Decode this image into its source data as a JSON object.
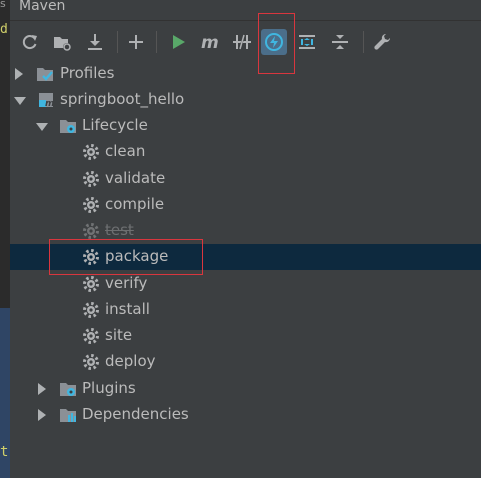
{
  "window": {
    "title": "Maven"
  },
  "editor_fragments": {
    "top": "s",
    "mid": "d",
    "bottom": "t"
  },
  "toolbar": {
    "buttons": [
      {
        "name": "reimport-icon"
      },
      {
        "name": "generate-sources-icon"
      },
      {
        "name": "download-icon"
      },
      {
        "name": "add-project-icon"
      },
      {
        "name": "run-icon"
      },
      {
        "name": "execute-goal-icon"
      },
      {
        "name": "toggle-offline-icon"
      },
      {
        "name": "skip-tests-icon",
        "active": true
      },
      {
        "name": "show-dependencies-icon"
      },
      {
        "name": "collapse-all-icon"
      },
      {
        "name": "settings-icon"
      }
    ]
  },
  "tree": {
    "profiles": "Profiles",
    "project": "springboot_hello",
    "lifecycle": {
      "label": "Lifecycle",
      "goals": [
        "clean",
        "validate",
        "compile",
        "test",
        "package",
        "verify",
        "install",
        "site",
        "deploy"
      ]
    },
    "plugins": "Plugins",
    "dependencies": "Dependencies"
  },
  "colors": {
    "background": "#3c3f41",
    "selection": "#0d293e",
    "highlight": "#d9363e",
    "run_green": "#59a869",
    "active_button_bg": "#4b6e8a"
  }
}
